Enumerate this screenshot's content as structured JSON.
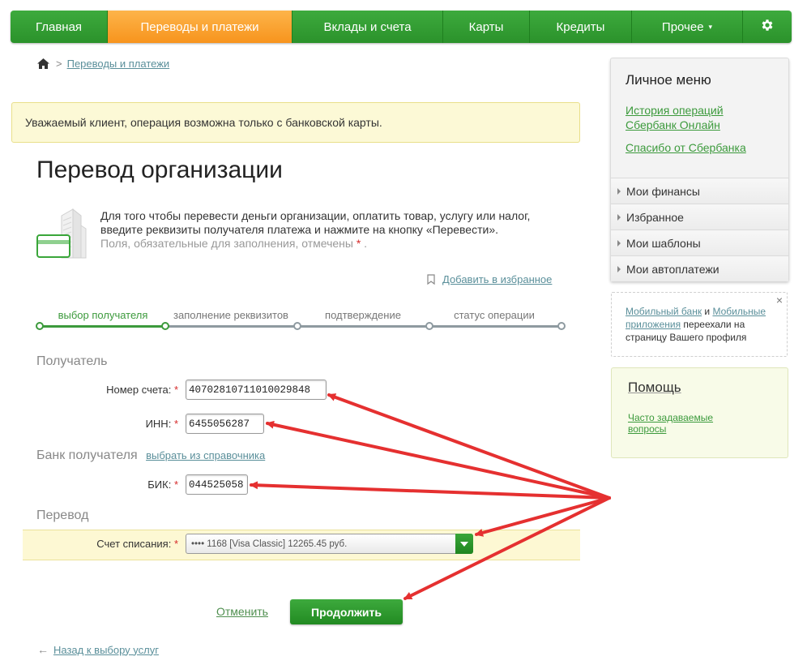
{
  "nav": {
    "items": [
      "Главная",
      "Переводы и платежи",
      "Вклады и счета",
      "Карты",
      "Кредиты",
      "Прочее"
    ],
    "more_caret": "▾",
    "settings_icon": "gear-icon",
    "active_color": "#f7941d",
    "brand_color": "#2e9a2e"
  },
  "breadcrumb": {
    "separator": ">",
    "current": "Переводы и платежи"
  },
  "notice": "Уважаемый клиент, операция возможна только с банковской карты.",
  "page": {
    "title": "Перевод организации",
    "intro_line1": "Для того чтобы перевести деньги организации, оплатить товар, услугу или налог,",
    "intro_line2": "введите реквизиты получателя платежа и нажмите на кнопку «Перевести».",
    "required_note": "Поля, обязательные для заполнения, отмечены",
    "star": "*",
    "dot": ".",
    "add_favorite": "Добавить в избранное"
  },
  "steps": [
    {
      "label": "выбор получателя",
      "active": true
    },
    {
      "label": "заполнение реквизитов",
      "active": false
    },
    {
      "label": "подтверждение",
      "active": false
    },
    {
      "label": "статус операции",
      "active": false
    }
  ],
  "recipient": {
    "section_title": "Получатель",
    "account_label": "Номер счета:",
    "account_value": "40702810711010029848",
    "inn_label": "ИНН:",
    "inn_value": "6455056287"
  },
  "bank": {
    "section_title": "Банк получателя",
    "directory_link": "выбрать из справочника",
    "bik_label": "БИК:",
    "bik_value": "044525058"
  },
  "transfer": {
    "section_title": "Перевод",
    "debit_label": "Счет списания:",
    "debit_value": "•••• 1168 [Visa Classic] 12265.45 руб."
  },
  "actions": {
    "cancel": "Отменить",
    "continue": "Продолжить",
    "back_arrow": "←",
    "back": "Назад к выбору услуг"
  },
  "sidebar": {
    "title": "Личное меню",
    "links": [
      "История операций Сбербанк Онлайн",
      "Спасибо от Сбербанка"
    ],
    "link_line1": "История операций",
    "link_line2": "Сбербанк Онлайн",
    "items": [
      "Мои финансы",
      "Избранное",
      "Мои шаблоны",
      "Мои автоплатежи"
    ]
  },
  "promo": {
    "close": "×",
    "link1": "Мобильный банк",
    "and": " и ",
    "link2": "Мобильные приложения",
    "text": " переехали на страницу Вашего профиля"
  },
  "help": {
    "title": "Помощь",
    "link_line1": "Часто задаваемые",
    "link_line2": "вопросы"
  },
  "annotation_color": "#e53030"
}
